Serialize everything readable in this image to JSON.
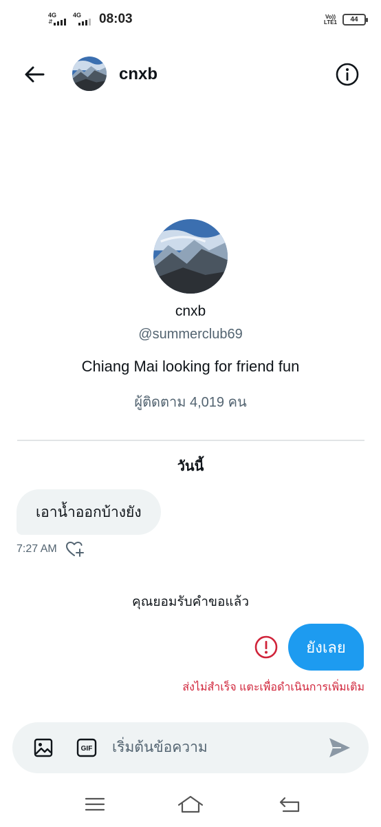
{
  "status_bar": {
    "sim1_network": "4G",
    "sim2_network": "4G",
    "time": "08:03",
    "volte_line1": "Vo))",
    "volte_line2": "LTE1",
    "battery": "44"
  },
  "header": {
    "name": "cnxb",
    "back_icon": "arrow-left-icon",
    "info_icon": "info-icon"
  },
  "profile": {
    "name": "cnxb",
    "handle": "@summerclub69",
    "bio": "Chiang Mai looking for friend fun",
    "followers": "ผู้ติดตาม 4,019 คน"
  },
  "conversation": {
    "date_label": "วันนี้",
    "incoming": {
      "text": "เอาน้ำออกบ้างยัง",
      "time": "7:27 AM"
    },
    "system_note": "คุณยอมรับคำขอแล้ว",
    "outgoing": {
      "text": "ยังเลย",
      "error_text": "ส่งไม่สำเร็จ แตะเพื่อดำเนินการเพิ่มเติม"
    }
  },
  "composer": {
    "placeholder": "เริ่มต้นข้อความ",
    "gif_label": "GIF"
  },
  "colors": {
    "accent": "#1d9bf0",
    "error": "#d0243a",
    "bubble_incoming": "#eff3f4",
    "secondary_text": "#536471"
  }
}
